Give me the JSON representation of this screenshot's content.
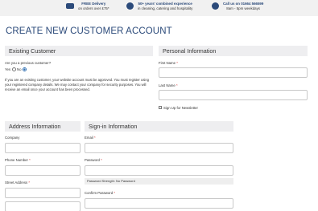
{
  "topbar": {
    "items": [
      {
        "title": "FREE Delivery",
        "subtitle": "on orders over £75*",
        "icon": "truck-icon"
      },
      {
        "title": "50+ years' combined experience",
        "subtitle": "in cleaning, catering and hospitality",
        "icon": "award-icon"
      },
      {
        "title": "Call us on 01664 566599",
        "subtitle": "8am - 5pm weekdays",
        "icon": "phone-icon"
      }
    ]
  },
  "page": {
    "title": "CREATE NEW CUSTOMER ACCOUNT"
  },
  "existing": {
    "header": "Existing Customer",
    "question": "Are you a previous customer?",
    "options": [
      "Yes",
      "No"
    ],
    "selected": "No",
    "paragraph": "If you are an existing customer, your website account must be approved. You must register using your registered company details. We may contact your company for security purposes. You will receive an email once your account has been processed."
  },
  "personal": {
    "header": "Personal Information",
    "first_name_label": "First Name",
    "last_name_label": "Last Name",
    "newsletter_label": "Sign Up for Newsletter"
  },
  "address": {
    "header": "Address Information",
    "company_label": "Company",
    "phone_label": "Phone Number",
    "street_label": "Street Address"
  },
  "signin": {
    "header": "Sign-in Information",
    "email_label": "Email",
    "password_label": "Password",
    "strength_text": "Password Strength: No Password",
    "confirm_label": "Confirm Password"
  },
  "required_mark": "*",
  "colors": {
    "brand": "#2b4a7a",
    "required": "#d23b3b",
    "section_bg": "#eeeef0",
    "topbar_bg": "#f1f1f1"
  }
}
